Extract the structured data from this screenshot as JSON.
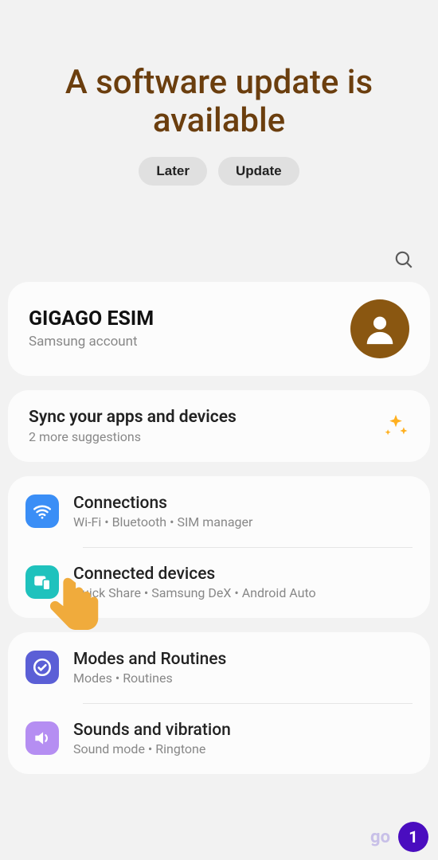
{
  "header": {
    "title": "A software update is available",
    "later_label": "Later",
    "update_label": "Update"
  },
  "account": {
    "name": "GIGAGO ESIM",
    "sub": "Samsung account"
  },
  "suggestion": {
    "title": "Sync your apps and devices",
    "sub": "2 more suggestions"
  },
  "groups": [
    {
      "items": [
        {
          "icon": "wifi",
          "color": "bg-blue",
          "title": "Connections",
          "sub": "Wi-Fi • Bluetooth • SIM manager"
        },
        {
          "icon": "devices",
          "color": "bg-teal",
          "title": "Connected devices",
          "sub": "Quick Share • Samsung DeX • Android Auto"
        }
      ]
    },
    {
      "items": [
        {
          "icon": "check",
          "color": "bg-indigo",
          "title": "Modes and Routines",
          "sub": "Modes • Routines"
        },
        {
          "icon": "sound",
          "color": "bg-purple",
          "title": "Sounds and vibration",
          "sub": "Sound mode • Ringtone"
        }
      ]
    }
  ],
  "footer": {
    "go": "go",
    "step": "1"
  }
}
